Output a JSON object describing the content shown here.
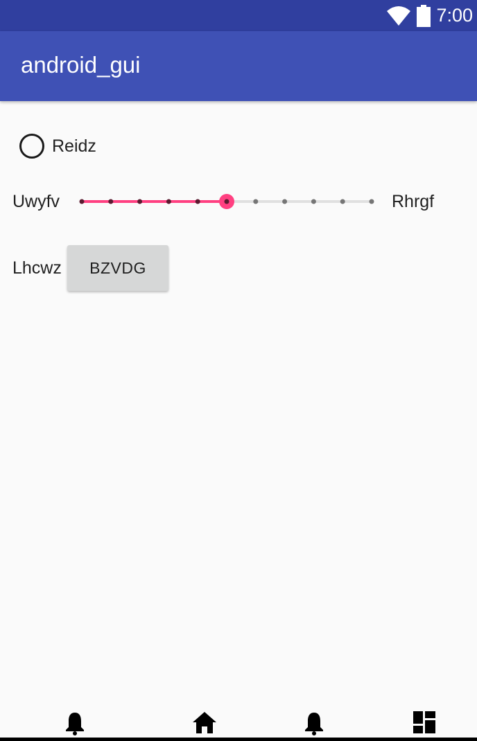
{
  "status_bar": {
    "time": "7:00",
    "icons": [
      "wifi-icon",
      "battery-icon"
    ]
  },
  "app_bar": {
    "title": "android_gui"
  },
  "radio": {
    "label": "Reidz",
    "checked": false
  },
  "slider": {
    "left_label": "Uwyfv",
    "right_label": "Rhrgf",
    "min": 0,
    "max": 10,
    "value": 5,
    "steps": 10
  },
  "button_row": {
    "label": "Lhcwz",
    "button_label": "BZVDG"
  },
  "bottom_nav": {
    "icons": [
      "bell-icon",
      "home-icon",
      "bell-icon",
      "dashboard-icon"
    ]
  },
  "colors": {
    "status_bar": "#303f9f",
    "app_bar": "#3f51b5",
    "accent": "#ff4081",
    "background": "#fafafa"
  }
}
